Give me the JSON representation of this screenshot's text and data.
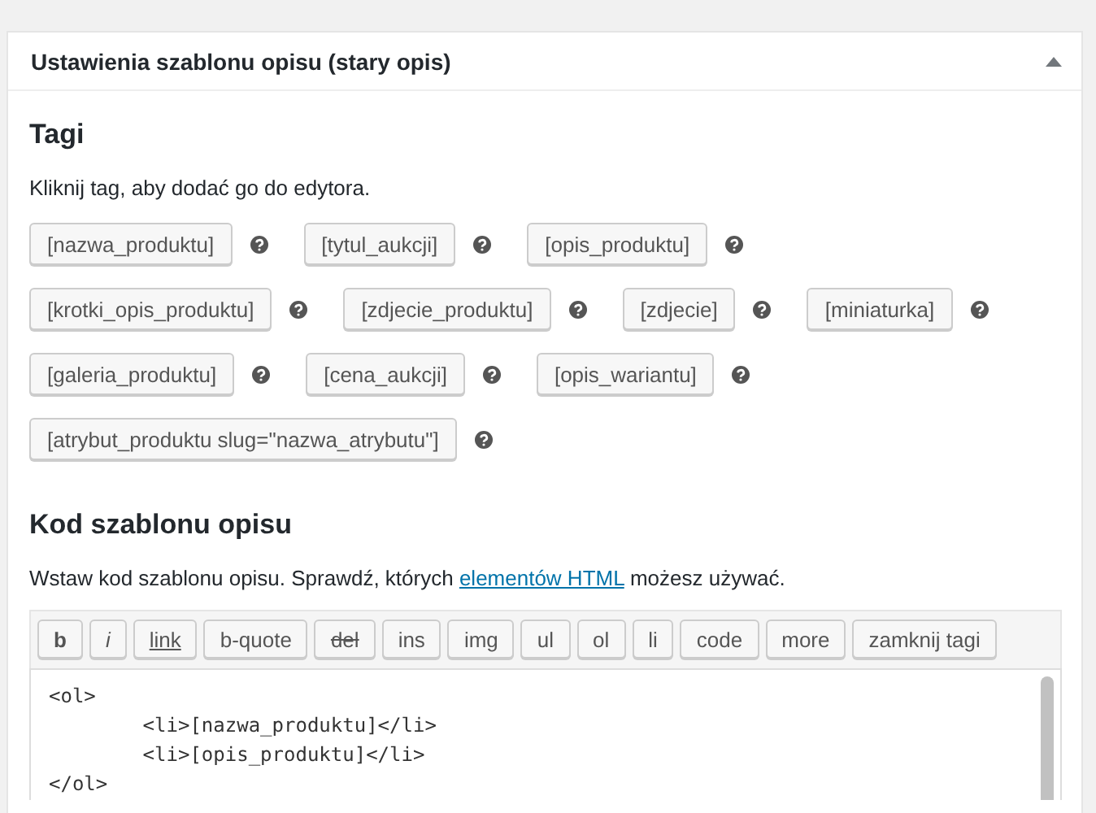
{
  "panel": {
    "title": "Ustawienia szablonu opisu (stary opis)",
    "expanded": true
  },
  "tags_section": {
    "heading": "Tagi",
    "description": "Kliknij tag, aby dodać go do edytora.",
    "rows": [
      [
        "[nazwa_produktu]",
        "[tytul_aukcji]",
        "[opis_produktu]"
      ],
      [
        "[krotki_opis_produktu]",
        "[zdjecie_produktu]",
        "[zdjecie]",
        "[miniaturka]"
      ],
      [
        "[galeria_produktu]",
        "[cena_aukcji]",
        "[opis_wariantu]"
      ],
      [
        "[atrybut_produktu slug=\"nazwa_atrybutu\"]"
      ]
    ]
  },
  "code_section": {
    "heading": "Kod szablonu opisu",
    "description_before": "Wstaw kod szablonu opisu. Sprawdź, których ",
    "link": "elementów HTML",
    "description_after": " możesz używać.",
    "toolbar": [
      {
        "label": "b",
        "kind": "bold"
      },
      {
        "label": "i",
        "kind": "italic"
      },
      {
        "label": "link",
        "kind": "link"
      },
      {
        "label": "b-quote",
        "kind": "plain"
      },
      {
        "label": "del",
        "kind": "strike"
      },
      {
        "label": "ins",
        "kind": "plain"
      },
      {
        "label": "img",
        "kind": "plain"
      },
      {
        "label": "ul",
        "kind": "plain"
      },
      {
        "label": "ol",
        "kind": "plain"
      },
      {
        "label": "li",
        "kind": "plain"
      },
      {
        "label": "code",
        "kind": "plain"
      },
      {
        "label": "more",
        "kind": "plain"
      },
      {
        "label": "zamknij tagi",
        "kind": "plain"
      }
    ],
    "code": "<ol>\n\t<li>[nazwa_produktu]</li>\n\t<li>[opis_produktu]</li>\n</ol>"
  }
}
